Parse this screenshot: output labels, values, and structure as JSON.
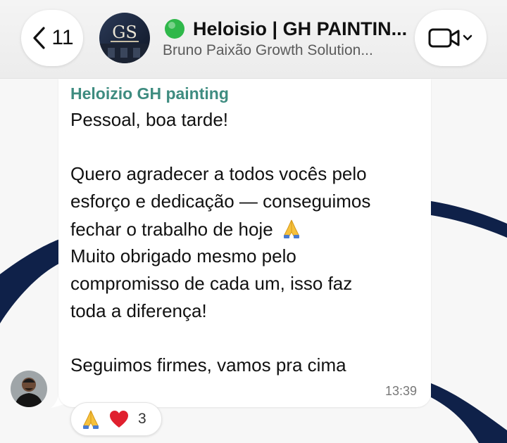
{
  "header": {
    "back_count": "11",
    "title": "Heloisio | GH PAINTIN...",
    "subtitle": "Bruno Paixão Growth Solution...",
    "group_avatar_initials": "GS",
    "status_color": "#2fb84a"
  },
  "message": {
    "sender": "Heloizio GH painting",
    "lines": [
      "Pessoal, boa tarde!",
      "Quero agradecer a todos vocês pelo",
      "esforço e dedicação — conseguimos",
      "fechar o trabalho de hoje",
      "Muito obrigado mesmo pelo",
      "compromisso de cada um, isso faz",
      "toda a diferença!",
      "Seguimos firmes, vamos pra cima"
    ],
    "inline_emoji": "folded-hands-icon",
    "time": "13:39"
  },
  "reactions": {
    "emojis": [
      "folded-hands-icon",
      "red-heart-icon"
    ],
    "count": "3"
  },
  "colors": {
    "sender_name": "#3e8c80",
    "wallpaper_stripe": "#0f2149",
    "heart": "#e0202e"
  }
}
